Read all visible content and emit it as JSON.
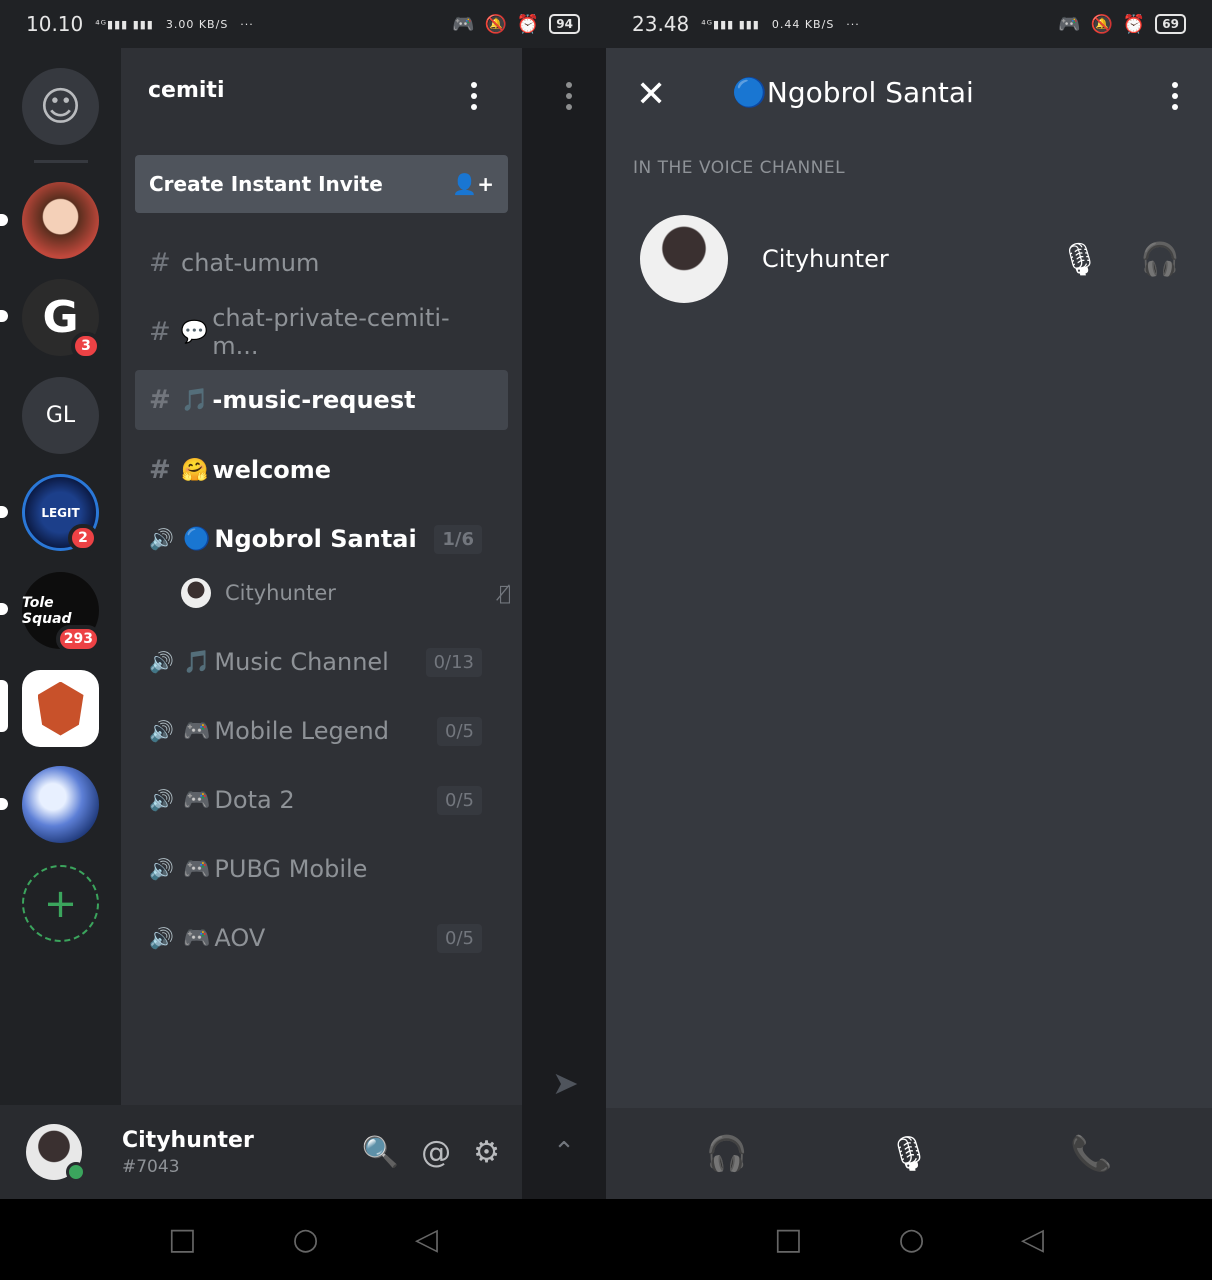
{
  "left_status": {
    "time": "10.10",
    "net": "3.00 KB/S",
    "battery": "94"
  },
  "right_status": {
    "time": "23.48",
    "net": "0.44 KB/S",
    "battery": "69"
  },
  "rail": {
    "servers": [
      {
        "label": "",
        "badge": ""
      },
      {
        "label": "G",
        "badge": "3"
      },
      {
        "label": "GL",
        "badge": ""
      },
      {
        "label": "",
        "badge": "2"
      },
      {
        "label": "",
        "badge": "293"
      },
      {
        "label": "",
        "badge": ""
      },
      {
        "label": "",
        "badge": ""
      }
    ],
    "add": "+"
  },
  "server_name": "cemiti",
  "invite_label": "Create Instant Invite",
  "channels": [
    {
      "name": "chat-umum",
      "emoji": ""
    },
    {
      "name": "chat-private-cemiti-m...",
      "emoji": "💬"
    },
    {
      "name": "-music-request",
      "emoji": "🎵"
    },
    {
      "name": "welcome",
      "emoji": "🤗"
    }
  ],
  "voice_channels": [
    {
      "name": "Ngobrol Santai",
      "emoji": "🔵",
      "count": "1/6"
    },
    {
      "name": "Music Channel",
      "emoji": "🎵",
      "count": "0/13"
    },
    {
      "name": "Mobile Legend",
      "emoji": "🎮",
      "count": "0/5"
    },
    {
      "name": "Dota 2",
      "emoji": "🎮",
      "count": "0/5"
    },
    {
      "name": "PUBG Mobile",
      "emoji": "🎮",
      "count": ""
    },
    {
      "name": "AOV",
      "emoji": "🎮",
      "count": "0/5"
    }
  ],
  "voice_user": "Cityhunter",
  "user": {
    "name": "Cityhunter",
    "tag": "#7043"
  },
  "voice_panel": {
    "title": "Ngobrol Santai",
    "title_emoji": "🔵",
    "section": "IN THE VOICE CHANNEL",
    "member": "Cityhunter"
  }
}
